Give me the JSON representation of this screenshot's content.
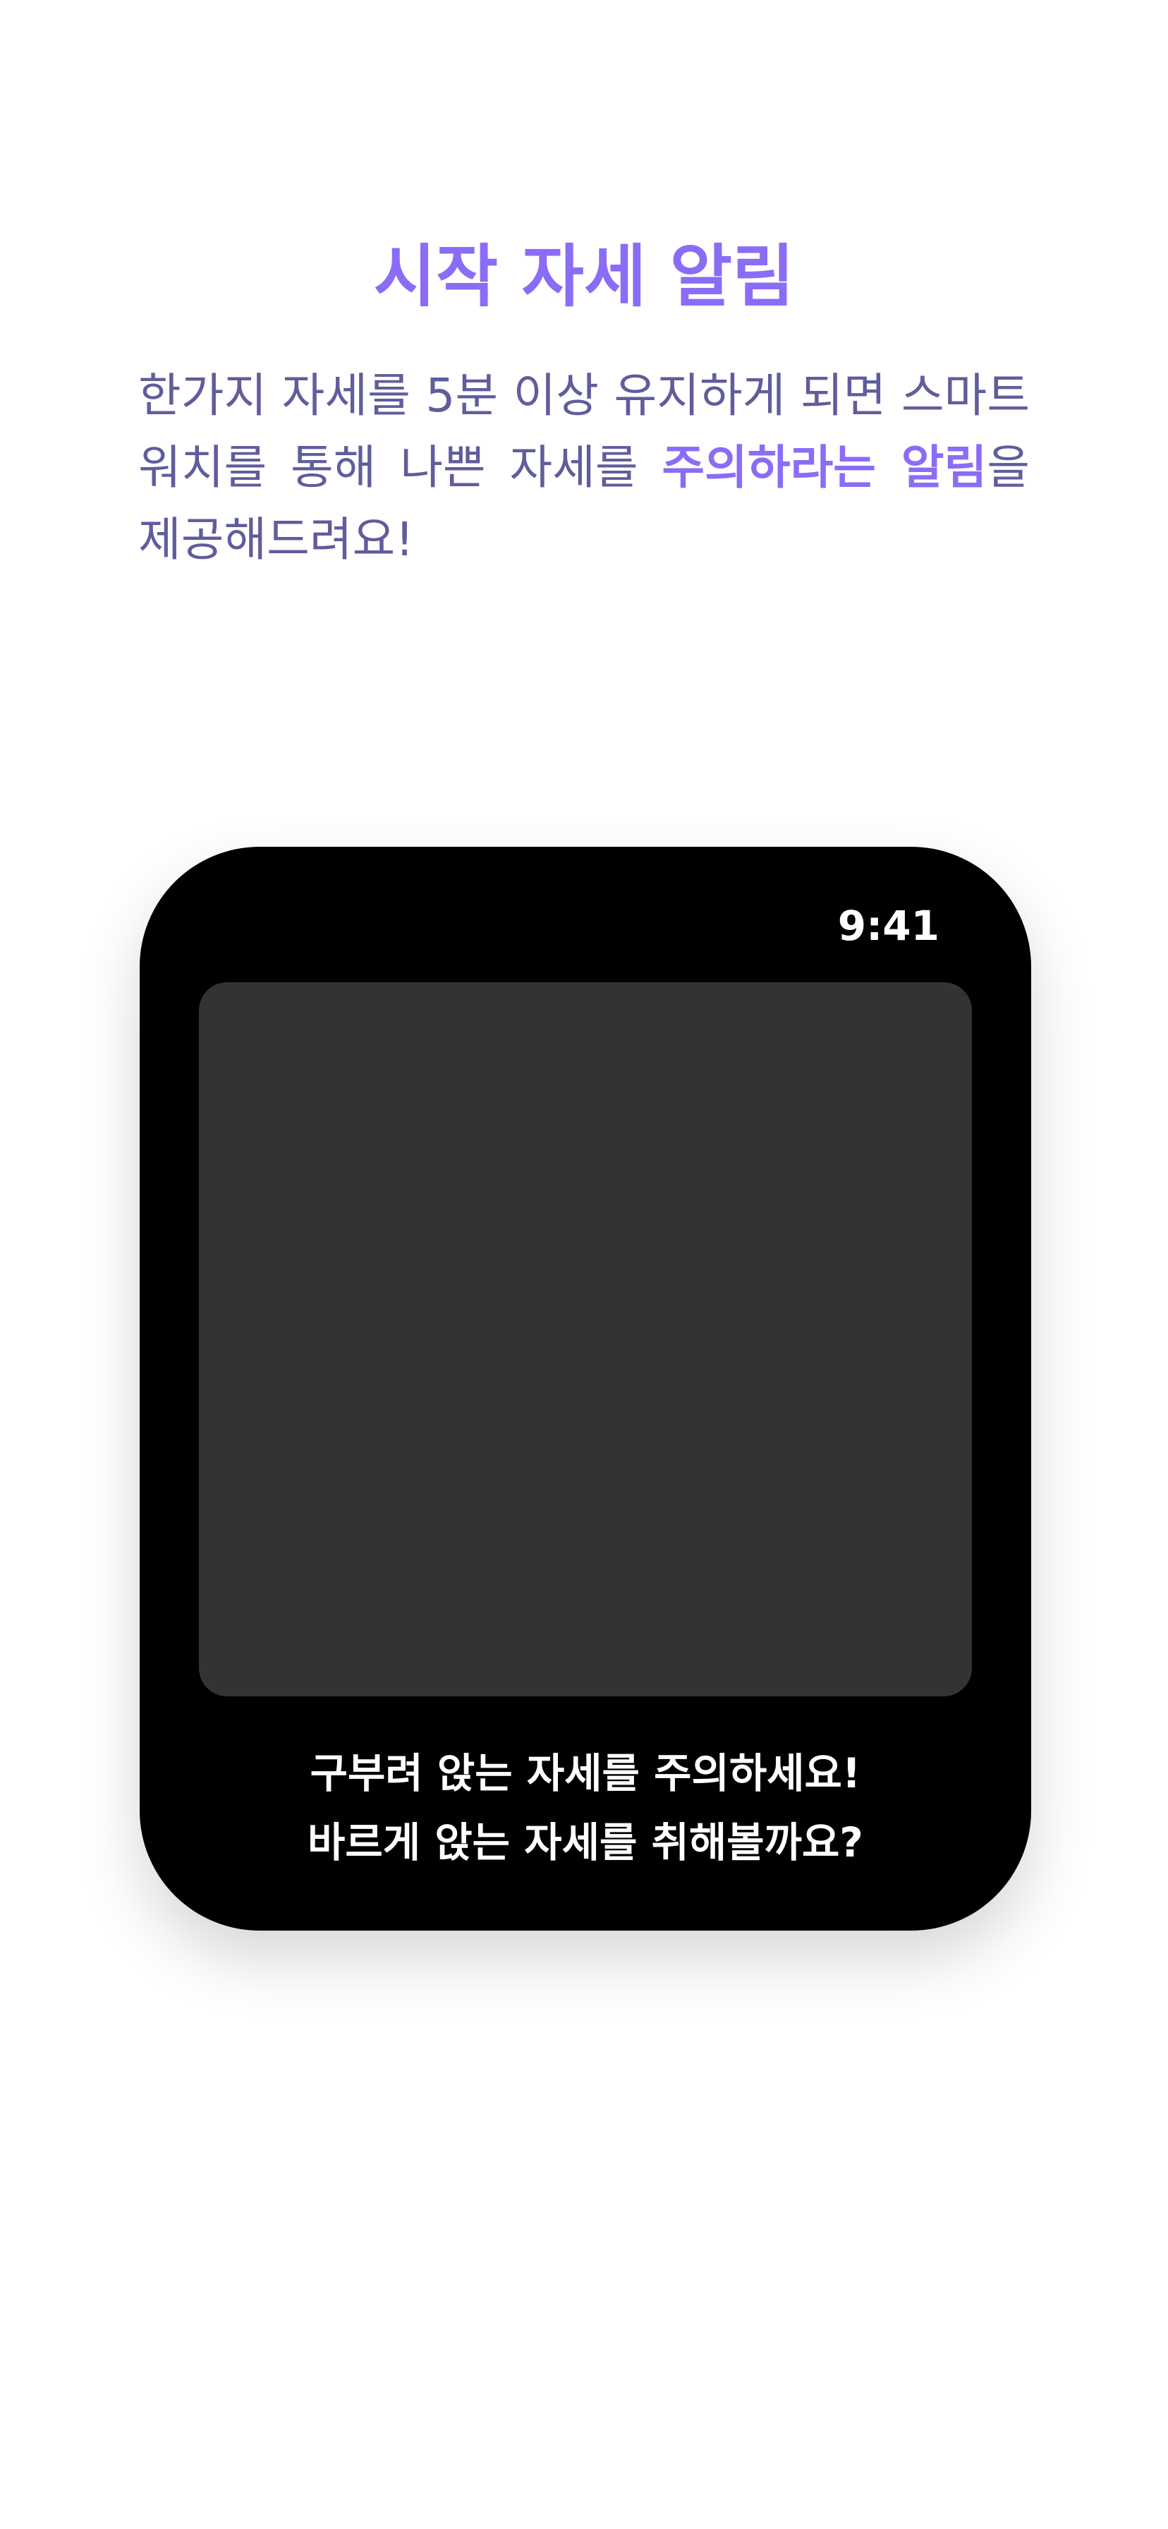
{
  "header": {
    "title": "시작 자세 알림",
    "description_part1": "한가지 자세를 5분 이상 유지하게 되면 스마트 워치를 통해 나쁜 자세를 ",
    "description_highlight": "주의하라는 알림",
    "description_part2": "을 제공해드려요!"
  },
  "watch": {
    "time": "9:41",
    "message_line1": "구부려 앉는 자세를 주의하세요!",
    "message_line2": "바르게 앉는 자세를 취해볼까요?"
  },
  "colors": {
    "accent": "#8b6cf6",
    "body_text": "#605d9c",
    "watch_body": "#000000",
    "watch_screen": "#333333"
  }
}
